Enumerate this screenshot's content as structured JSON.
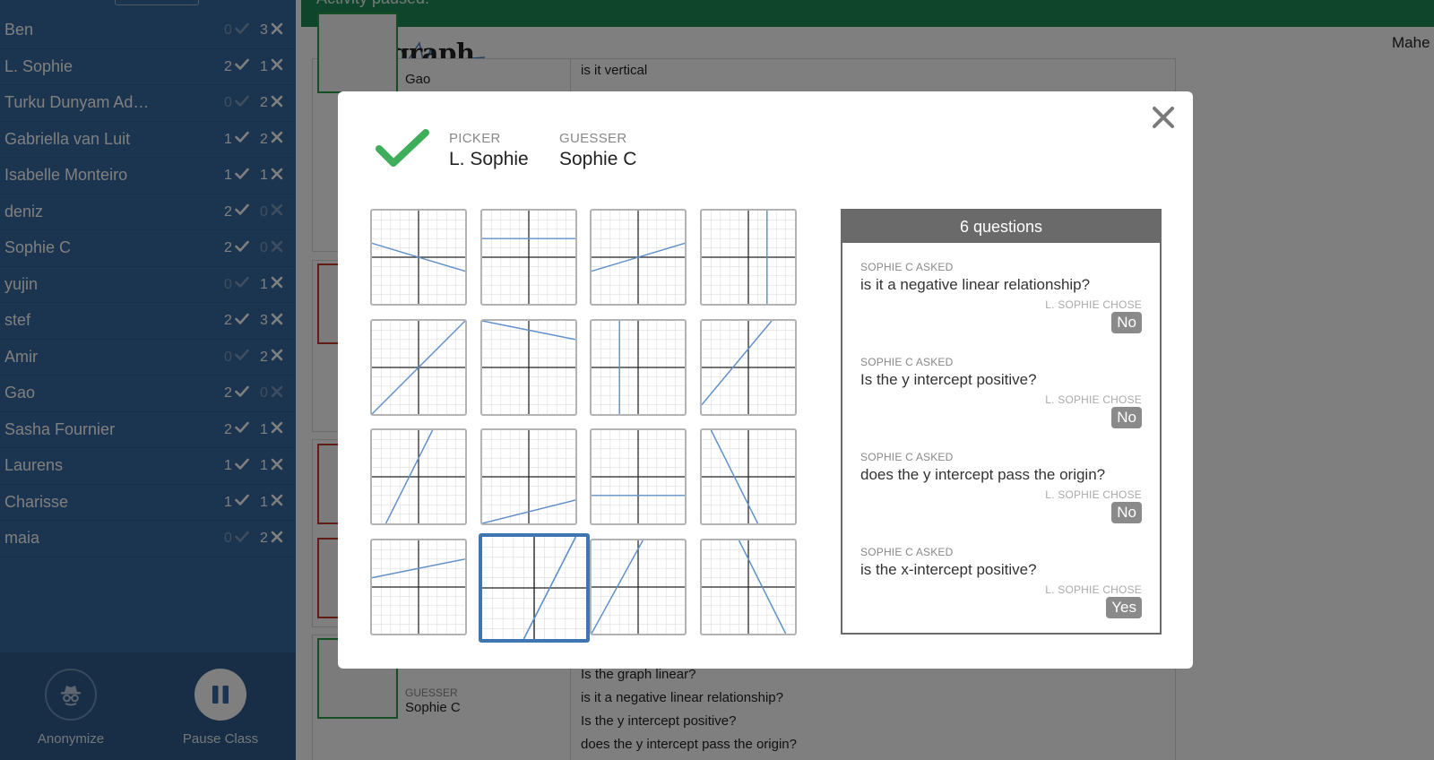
{
  "banner": {
    "text": "Activity paused."
  },
  "app": {
    "title": "Polygraph",
    "teacher": "Mahe"
  },
  "students": [
    {
      "name": "Ben",
      "correct": 0,
      "wrong": 3
    },
    {
      "name": "L. Sophie",
      "correct": 2,
      "wrong": 1
    },
    {
      "name": "Turku Dunyam Ad…",
      "correct": 0,
      "wrong": 2
    },
    {
      "name": "Gabriella van Luit",
      "correct": 1,
      "wrong": 2
    },
    {
      "name": "Isabelle Monteiro",
      "correct": 1,
      "wrong": 1
    },
    {
      "name": "deniz",
      "correct": 2,
      "wrong": 0
    },
    {
      "name": "Sophie C",
      "correct": 2,
      "wrong": 0
    },
    {
      "name": "yujin",
      "correct": 0,
      "wrong": 1
    },
    {
      "name": "stef",
      "correct": 2,
      "wrong": 3
    },
    {
      "name": "Amir",
      "correct": 0,
      "wrong": 2
    },
    {
      "name": "Gao",
      "correct": 2,
      "wrong": 0
    },
    {
      "name": "Sasha Fournier",
      "correct": 2,
      "wrong": 1
    },
    {
      "name": "Laurens",
      "correct": 1,
      "wrong": 1
    },
    {
      "name": "Charisse",
      "correct": 1,
      "wrong": 1
    },
    {
      "name": "maia",
      "correct": 0,
      "wrong": 2
    }
  ],
  "sidebar_footer": {
    "anonymize_label": "Anonymize",
    "pause_label": "Pause Class"
  },
  "background": {
    "top_card": {
      "name": "Gao",
      "question": "is it vertical"
    },
    "bottom_card": {
      "guesser_label": "GUESSER",
      "guesser_name": "Sophie C",
      "questions": [
        "Is the graph linear?",
        "is it a negative linear relationship?",
        "Is the y intercept positive?",
        "does the y intercept pass the origin?"
      ]
    }
  },
  "modal": {
    "picker_label": "PICKER",
    "picker_name": "L. Sophie",
    "guesser_label": "GUESSER",
    "guesser_name": "Sophie C",
    "result": "correct",
    "questions_header": "6 questions",
    "questions": [
      {
        "asker": "SOPHIE C ASKED",
        "text": "is it a negative linear relationship?",
        "chooser": "L. SOPHIE CHOSE",
        "answer": "No"
      },
      {
        "asker": "SOPHIE C ASKED",
        "text": "Is the y intercept positive?",
        "chooser": "L. SOPHIE CHOSE",
        "answer": "No"
      },
      {
        "asker": "SOPHIE C ASKED",
        "text": "does the y intercept pass the origin?",
        "chooser": "L. SOPHIE CHOSE",
        "answer": "No"
      },
      {
        "asker": "SOPHIE C ASKED",
        "text": "is the x-intercept positive?",
        "chooser": "L. SOPHIE CHOSE",
        "answer": "Yes"
      }
    ],
    "graphs": [
      {
        "line": [
          -5,
          1.5,
          5,
          -1.5
        ],
        "selected": false
      },
      {
        "line": [
          -5,
          2,
          5,
          2
        ],
        "selected": false
      },
      {
        "line": [
          -5,
          -1.5,
          5,
          1.5
        ],
        "selected": false
      },
      {
        "line": [
          2,
          -5,
          2,
          5
        ],
        "selected": false
      },
      {
        "line": [
          -5,
          -5,
          5,
          5
        ],
        "selected": false
      },
      {
        "line": [
          -5,
          5,
          5,
          3
        ],
        "selected": false
      },
      {
        "line": [
          -2,
          -5,
          -2,
          5
        ],
        "selected": false
      },
      {
        "line": [
          -5,
          -4,
          2.5,
          5
        ],
        "selected": false
      },
      {
        "line": [
          -3.5,
          -5,
          1.5,
          5
        ],
        "selected": false
      },
      {
        "line": [
          -5,
          -5,
          5,
          -2.5
        ],
        "selected": false
      },
      {
        "line": [
          -5,
          -2,
          5,
          -2
        ],
        "selected": false
      },
      {
        "line": [
          -4,
          5,
          1,
          -5
        ],
        "selected": false
      },
      {
        "line": [
          -5,
          1,
          5,
          3
        ],
        "selected": false
      },
      {
        "line": [
          -1,
          -5,
          4,
          5
        ],
        "selected": true
      },
      {
        "line": [
          -5,
          -5,
          0.5,
          5
        ],
        "selected": false
      },
      {
        "line": [
          -1,
          5,
          4,
          -5
        ],
        "selected": false
      }
    ],
    "colors": {
      "line": "#5f8fc7",
      "selected_border": "#3f76b2",
      "check": "#3fae5b",
      "answer_bg": "#8a8a8a"
    }
  }
}
